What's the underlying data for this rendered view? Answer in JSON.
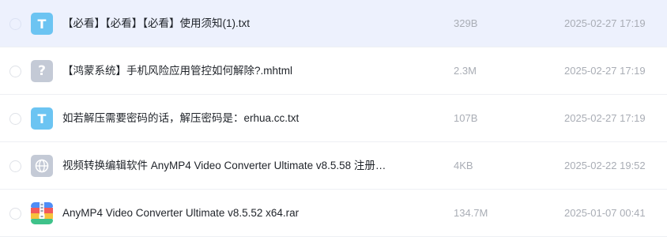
{
  "files": [
    {
      "name": "【必看】【必看】【必看】使用须知(1).txt",
      "size": "329B",
      "date": "2025-02-27 17:19",
      "icon": "txt-file-icon",
      "icon_glyph": "T"
    },
    {
      "name": "【鸿蒙系统】手机风险应用管控如何解除?.mhtml",
      "size": "2.3M",
      "date": "2025-02-27 17:19",
      "icon": "unknown-file-icon",
      "icon_glyph": "?"
    },
    {
      "name": "如若解压需要密码的话，解压密码是：erhua.cc.txt",
      "size": "107B",
      "date": "2025-02-27 17:19",
      "icon": "txt-file-icon",
      "icon_glyph": "T"
    },
    {
      "name": "视频转换编辑软件 AnyMP4 Video Converter Ultimate v8.5.58 注册…",
      "size": "4KB",
      "date": "2025-02-22 19:52",
      "icon": "web-link-icon"
    },
    {
      "name": "AnyMP4 Video Converter Ultimate v8.5.52 x64.rar",
      "size": "134.7M",
      "date": "2025-01-07 00:41",
      "icon": "rar-archive-icon"
    }
  ],
  "colors": {
    "hover_row": "#edf1fd",
    "txt_icon": "#6cc4f2",
    "generic_icon": "#c4cad6",
    "meta_text": "#a9adb5"
  }
}
